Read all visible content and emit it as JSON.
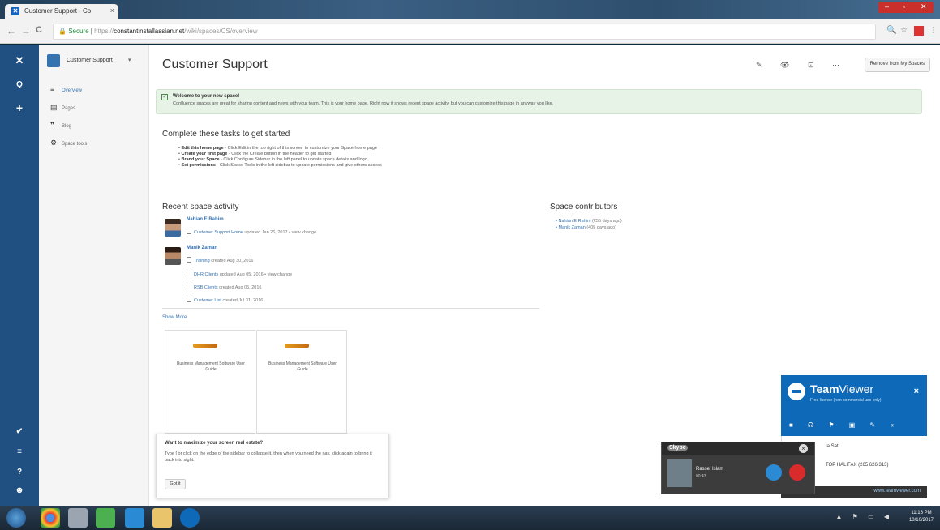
{
  "browser": {
    "tab_title": "Customer Support - Co",
    "tab_close": "×",
    "secure_label": "Secure",
    "url_scheme": "https://",
    "url_host": "constantinstallassian.net",
    "url_path": "/wiki/spaces/CS/overview",
    "back": "←",
    "forward": "→",
    "reload": "C"
  },
  "globalnav": {
    "logo": "✕",
    "search": "Q",
    "create": "+",
    "notifications": "✔",
    "menu": "≡",
    "help": "?",
    "profile": "☻"
  },
  "sidebar": {
    "space_name": "Customer Support",
    "caret": "▾",
    "items": [
      {
        "icon": "≡",
        "label": "Overview"
      },
      {
        "icon": "▤",
        "label": "Pages"
      },
      {
        "icon": "❞",
        "label": "Blog"
      },
      {
        "icon": "⚙",
        "label": "Space tools"
      }
    ]
  },
  "main": {
    "title": "Customer Support",
    "tools": "✎ 👁 ⊡ ⋯",
    "remove_button": "Remove from My Spaces",
    "welcome_title": "Welcome to your new space!",
    "welcome_body": "Confluence spaces are great for sharing content and news with your team. This is your home page. Right now it shows recent space activity, but you can customize this page in anyway you like.",
    "tasks_heading": "Complete these tasks to get started",
    "tasks": [
      {
        "bold": "Edit this home page",
        "text": " - Click Edit in the top right of this screen to customize your Space home page"
      },
      {
        "bold": "Create your first page",
        "text": " - Click the Create button in the header to get started"
      },
      {
        "bold": "Brand your Space",
        "text": " - Click Configure Sidebar in the left panel to update space details and logo"
      },
      {
        "bold": "Set permissions",
        "text": " - Click Space Tools in the left sidebar to update permissions and give others access"
      }
    ],
    "recent_heading": "Recent space activity",
    "authors": [
      {
        "name": "Nahian E Rahim",
        "items": [
          {
            "title": "Customer Support Home",
            "meta": " updated Jan 26, 2017 • view change"
          }
        ]
      },
      {
        "name": "Manik Zaman",
        "items": [
          {
            "title": "Training",
            "meta": " created Aug 30, 2016"
          },
          {
            "title": "DHR Clients",
            "meta": " updated Aug 05, 2016 • view change"
          },
          {
            "title": "RSB Clients",
            "meta": " created Aug 05, 2016"
          },
          {
            "title": "Customer List",
            "meta": " created Jul 31, 2016"
          }
        ]
      }
    ],
    "show_more": "Show More",
    "contributors_heading": "Space contributors",
    "contributors": [
      {
        "name": "Nahian E Rahim",
        "meta": " (255 days ago)"
      },
      {
        "name": "Manik Zaman",
        "meta": " (405 days ago)"
      }
    ],
    "cards": [
      {
        "title": "Business Management Software User Guide"
      },
      {
        "title": "Business Management Software User Guide"
      }
    ],
    "tip_title": "Want to maximize your screen real estate?",
    "tip_body": "Type [ or click on the edge of the sidebar to collapse it, then when you need the nav, click again to bring it back into sight.",
    "tip_button": "Got it"
  },
  "teamviewer": {
    "name_bold": "Team",
    "name_light": "Viewer",
    "close": "×",
    "subtitle": "Free license (non-commercial use only)",
    "icons": "■ ☊ ⚑ ▣ ✎ «",
    "list": [
      {
        "label": "Ia Sat"
      },
      {
        "label": "TOP HALIFAX (265 626 313)"
      }
    ],
    "link": "www.teamviewer.com"
  },
  "skype": {
    "logo": "Skype",
    "close": "×",
    "caller": "Rassel Islam",
    "duration": "00:43"
  },
  "taskbar": {
    "tray": "▲ ⚑ ▭ ◀",
    "time": "11:16 PM",
    "date": "10/10/2017"
  },
  "colors": {
    "confluence_nav": "#205081",
    "link_blue": "#3572b0",
    "welcome_bg": "#e8f3e8",
    "teamviewer_blue": "#0e6ab8",
    "hangup_red": "#d92b2b"
  }
}
